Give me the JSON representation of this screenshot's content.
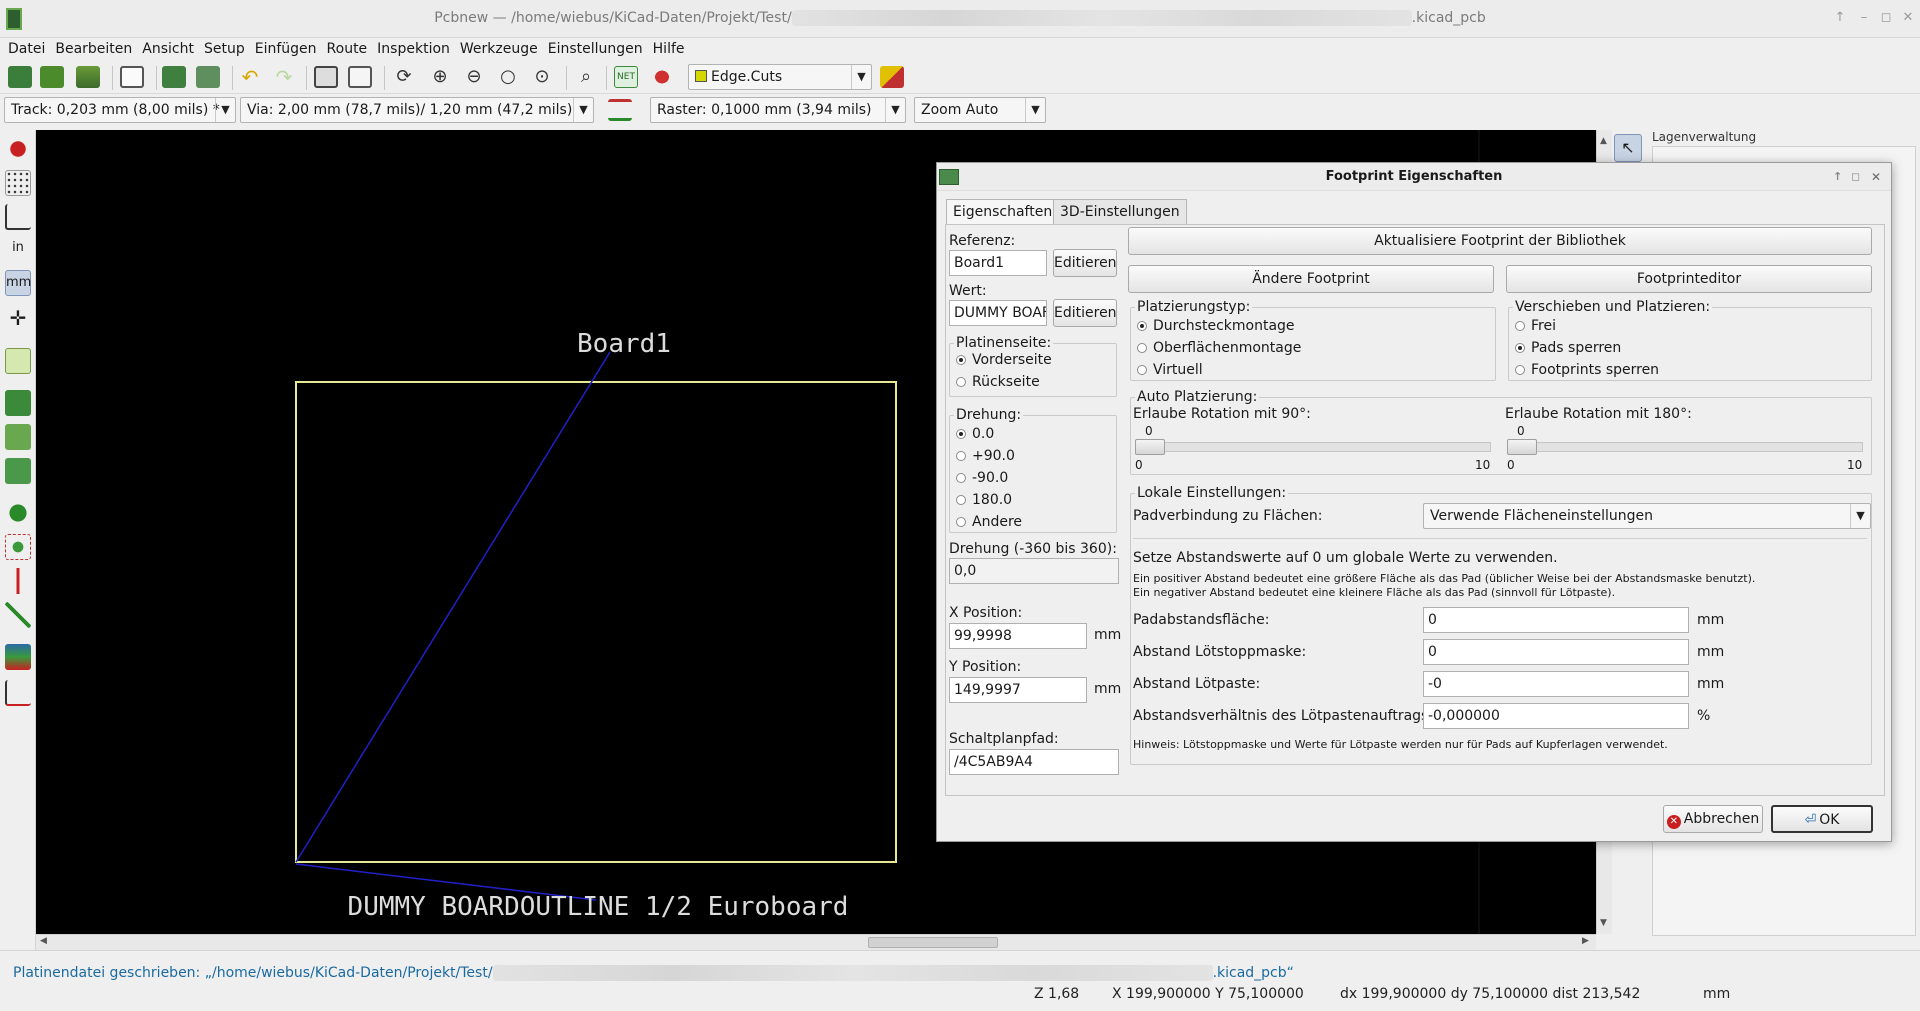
{
  "window": {
    "title_prefix": "Pcbnew — /home/wiebus/KiCad-Daten/Projekt/Test/",
    "title_suffix": ".kicad_pcb"
  },
  "menu": [
    "Datei",
    "Bearbeiten",
    "Ansicht",
    "Setup",
    "Einfügen",
    "Route",
    "Inspektion",
    "Werkzeuge",
    "Einstellungen",
    "Hilfe"
  ],
  "toolbar": {
    "layer_select": "Edge.Cuts",
    "layer_color": "#d6d600"
  },
  "toolbar2": {
    "track": "Track: 0,203 mm (8,00 mils) *",
    "via": "Via: 2,00 mm (78,7 mils)/ 1,20 mm (47,2 mils)",
    "grid": "Raster: 0,1000 mm (3,94 mils)",
    "zoom": "Zoom Auto"
  },
  "left_toolbar": {
    "units_in": "in",
    "units_mm": "mm"
  },
  "canvas": {
    "reference_text": "Board1",
    "value_text": "DUMMY BOARDOUTLINE 1/2 Euroboard",
    "outline_color": "#e8e890",
    "ratsnest_color": "#2020c8"
  },
  "right_panel": {
    "title": "Lagenverwaltung"
  },
  "status": {
    "message_prefix": "Platinendatei geschrieben: „/home/wiebus/KiCad-Daten/Projekt/Test/",
    "message_suffix": ".kicad_pcb“",
    "zoom": "Z 1,68",
    "xy": "X 199,900000  Y 75,100000",
    "dxdy": "dx 199,900000  dy 75,100000  dist 213,542",
    "unit": "mm"
  },
  "dialog": {
    "title": "Footprint Eigenschaften",
    "tabs": [
      "Eigenschaften",
      "3D-Einstellungen"
    ],
    "referenz_label": "Referenz:",
    "referenz_value": "Board1",
    "wert_label": "Wert:",
    "wert_value": "DUMMY BOAF",
    "edit_label": "Editieren",
    "platinenseite": {
      "title": "Platinenseite:",
      "options": [
        "Vorderseite",
        "Rückseite"
      ],
      "selected": 0
    },
    "drehung": {
      "title": "Drehung:",
      "options": [
        "0.0",
        "+90.0",
        "-90.0",
        "180.0",
        "Andere"
      ],
      "selected": 0
    },
    "drehung_custom_label": "Drehung (-360 bis 360):",
    "drehung_custom_value": "0,0",
    "x_label": "X Position:",
    "x_value": "99,9998",
    "y_label": "Y Position:",
    "y_value": "149,9997",
    "unit_mm": "mm",
    "schaltplan_label": "Schaltplanpfad:",
    "schaltplan_value": "/4C5AB9A4",
    "btn_update": "Aktualisiere Footprint der Bibliothek",
    "btn_change": "Ändere Footprint",
    "btn_editor": "Footprinteditor",
    "platzierungstyp": {
      "title": "Platzierungstyp:",
      "options": [
        "Durchsteckmontage",
        "Oberflächenmontage",
        "Virtuell"
      ],
      "selected": 0
    },
    "verschieben": {
      "title": "Verschieben und Platzieren:",
      "options": [
        "Frei",
        "Pads sperren",
        "Footprints sperren"
      ],
      "selected": 1
    },
    "auto_place": {
      "title": "Auto Platzierung:",
      "rot90_label": "Erlaube Rotation mit 90°:",
      "rot90_value": "0",
      "rot180_label": "Erlaube Rotation mit 180°:",
      "rot180_value": "0",
      "min": "0",
      "max": "10"
    },
    "local": {
      "title": "Lokale Einstellungen:",
      "pad_conn_label": "Padverbindung zu Flächen:",
      "pad_conn_value": "Verwende Flächeneinstellungen",
      "info_main": "Setze Abstandswerte auf 0 um globale Werte zu verwenden.",
      "info_pos": "Ein positiver Abstand bedeutet eine größere Fläche als das Pad (üblicher Weise bei der Abstandsmaske benutzt).",
      "info_neg": "Ein negativer Abstand bedeutet eine kleinere Fläche als das Pad (sinnvoll für Lötpaste).",
      "pad_clear_label": "Padabstandsfläche:",
      "pad_clear_value": "0",
      "mask_label": "Abstand Lötstoppmaske:",
      "mask_value": "0",
      "paste_label": "Abstand Lötpaste:",
      "paste_value": "-0",
      "ratio_label": "Abstandsverhältnis des Lötpastenauftrags:",
      "ratio_value": "-0,000000",
      "percent": "%",
      "hint": "Hinweis: Lötstoppmaske und Werte für Lötpaste werden nur für Pads auf Kupferlagen verwendet."
    },
    "cancel_label": "Abbrechen",
    "ok_label": "OK"
  }
}
